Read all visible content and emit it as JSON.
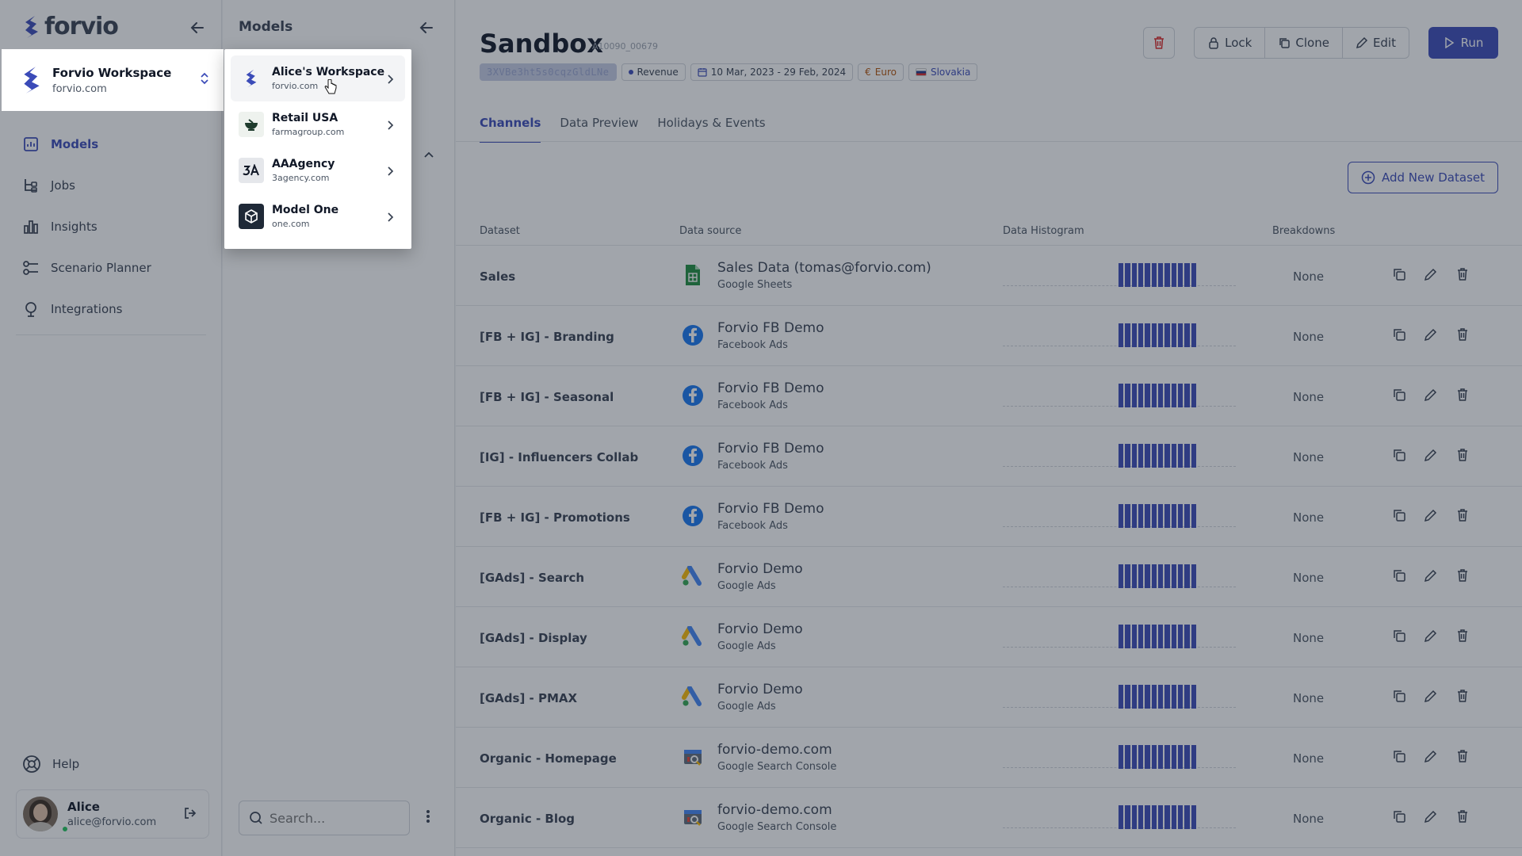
{
  "app": {
    "logo_text": "forvio",
    "brand_color": "#3b4bb8"
  },
  "workspace": {
    "name": "Forvio Workspace",
    "domain": "forvio.com"
  },
  "sidebar": {
    "items": [
      {
        "label": "Models",
        "icon": "models-icon",
        "active": true
      },
      {
        "label": "Jobs",
        "icon": "jobs-icon"
      },
      {
        "label": "Insights",
        "icon": "insights-icon"
      },
      {
        "label": "Scenario Planner",
        "icon": "scenario-icon"
      },
      {
        "label": "Integrations",
        "icon": "integrations-icon"
      }
    ],
    "help_label": "Help",
    "user": {
      "name": "Alice",
      "email": "alice@forvio.com"
    }
  },
  "models_panel": {
    "title": "Models",
    "search_placeholder": "Search..."
  },
  "workspace_dropdown": {
    "items": [
      {
        "name": "Alice's Workspace",
        "domain": "forvio.com",
        "icon": "forvio-logo-icon"
      },
      {
        "name": "Retail USA",
        "domain": "farmagroup.com",
        "icon": "mortar-icon"
      },
      {
        "name": "AAAgency",
        "domain": "3agency.com",
        "icon": "aaagency-logo-icon"
      },
      {
        "name": "Model One",
        "domain": "one.com",
        "icon": "cube-icon"
      }
    ]
  },
  "model": {
    "title": "Sandbox",
    "id": "A10090_00679",
    "tags": {
      "redacted": "3XVBe3ht5s0cqzGldLNe",
      "target": "Revenue",
      "date_range": "10 Mar, 2023 - 29 Feb, 2024",
      "currency": "Euro",
      "country": "Slovakia"
    }
  },
  "actions": {
    "lock": "Lock",
    "clone": "Clone",
    "edit": "Edit",
    "run": "Run",
    "add_dataset": "Add New Dataset"
  },
  "tabs": [
    {
      "label": "Channels",
      "active": true
    },
    {
      "label": "Data Preview"
    },
    {
      "label": "Holidays & Events"
    }
  ],
  "table": {
    "headers": {
      "dataset": "Dataset",
      "source": "Data source",
      "histogram": "Data Histogram",
      "breakdowns": "Breakdowns"
    },
    "rows": [
      {
        "dataset": "Sales",
        "source_name": "Sales Data (tomas@forvio.com)",
        "source_type": "Google Sheets",
        "icon": "google-sheets-icon",
        "breakdowns": "None"
      },
      {
        "dataset": "[FB + IG] - Branding",
        "source_name": "Forvio FB Demo",
        "source_type": "Facebook Ads",
        "icon": "facebook-icon",
        "breakdowns": "None"
      },
      {
        "dataset": "[FB + IG] - Seasonal",
        "source_name": "Forvio FB Demo",
        "source_type": "Facebook Ads",
        "icon": "facebook-icon",
        "breakdowns": "None"
      },
      {
        "dataset": "[IG] - Influencers Collab",
        "source_name": "Forvio FB Demo",
        "source_type": "Facebook Ads",
        "icon": "facebook-icon",
        "breakdowns": "None"
      },
      {
        "dataset": "[FB + IG] - Promotions",
        "source_name": "Forvio FB Demo",
        "source_type": "Facebook Ads",
        "icon": "facebook-icon",
        "breakdowns": "None"
      },
      {
        "dataset": "[GAds] - Search",
        "source_name": "Forvio Demo",
        "source_type": "Google Ads",
        "icon": "google-ads-icon",
        "breakdowns": "None"
      },
      {
        "dataset": "[GAds] - Display",
        "source_name": "Forvio Demo",
        "source_type": "Google Ads",
        "icon": "google-ads-icon",
        "breakdowns": "None"
      },
      {
        "dataset": "[GAds] - PMAX",
        "source_name": "Forvio Demo",
        "source_type": "Google Ads",
        "icon": "google-ads-icon",
        "breakdowns": "None"
      },
      {
        "dataset": "Organic - Homepage",
        "source_name": "forvio-demo.com",
        "source_type": "Google Search Console",
        "icon": "search-console-icon",
        "breakdowns": "None"
      },
      {
        "dataset": "Organic - Blog",
        "source_name": "forvio-demo.com",
        "source_type": "Google Search Console",
        "icon": "search-console-icon",
        "breakdowns": "None"
      }
    ]
  }
}
